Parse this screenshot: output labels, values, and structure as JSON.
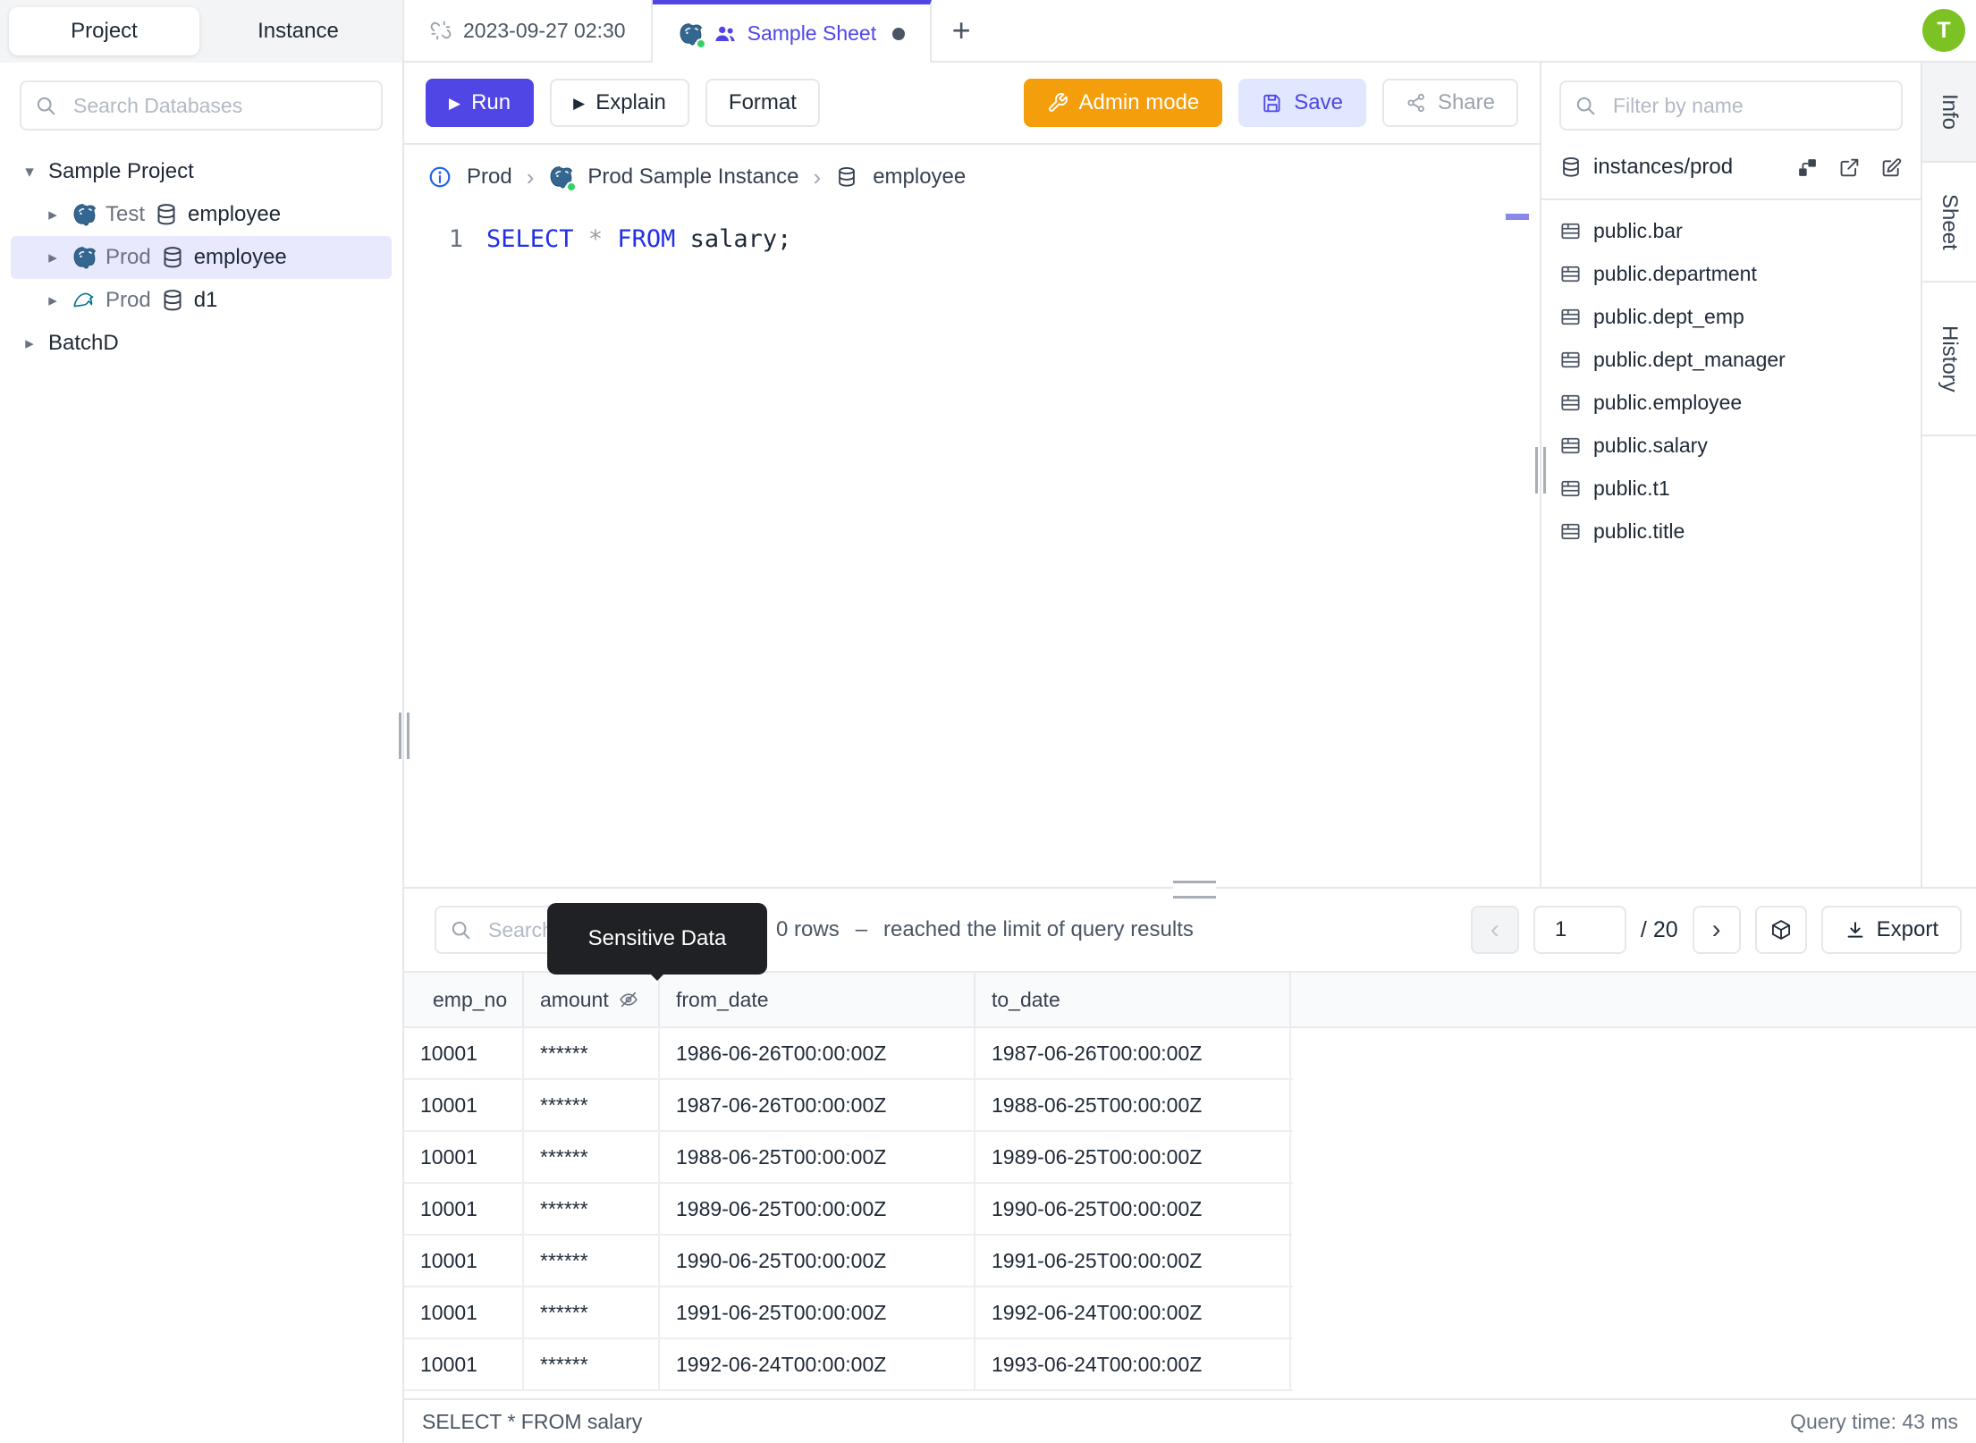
{
  "user": {
    "avatar_initial": "T"
  },
  "left_sidebar": {
    "tabs": {
      "project": "Project",
      "instance": "Instance"
    },
    "search_placeholder": "Search Databases",
    "tree": {
      "root": "Sample Project",
      "databases": [
        {
          "env": "Test",
          "name": "employee",
          "engine": "postgresql"
        },
        {
          "env": "Prod",
          "name": "employee",
          "engine": "postgresql"
        },
        {
          "env": "Prod",
          "name": "d1",
          "engine": "mysql"
        }
      ],
      "collapsed_project": "BatchD"
    }
  },
  "tab_bar": {
    "tabs": [
      {
        "label": "2023-09-27 02:30"
      },
      {
        "label": "Sample Sheet"
      }
    ]
  },
  "toolbar": {
    "run": "Run",
    "explain": "Explain",
    "format": "Format",
    "admin_mode": "Admin mode",
    "save": "Save",
    "share": "Share"
  },
  "breadcrumb": {
    "environment": "Prod",
    "instance": "Prod Sample Instance",
    "database": "employee"
  },
  "editor": {
    "line_number": "1",
    "keyword_select": "SELECT",
    "operator": "*",
    "keyword_from": "FROM",
    "identifier": " salary;"
  },
  "right_sidebar": {
    "filter_placeholder": "Filter by name",
    "schema_path": "instances/prod",
    "tables": [
      "public.bar",
      "public.department",
      "public.dept_emp",
      "public.dept_manager",
      "public.employee",
      "public.salary",
      "public.t1",
      "public.title"
    ]
  },
  "side_tabs": {
    "info": "Info",
    "sheet": "Sheet",
    "history": "History"
  },
  "results": {
    "search_placeholder": "Search",
    "tooltip": "Sensitive Data",
    "rows_text": "0 rows",
    "dash": "–",
    "limit_text": "reached the limit of query results",
    "pagination": {
      "page": "1",
      "total": "/ 20"
    },
    "export_label": "Export",
    "table": {
      "headers": [
        "emp_no",
        "amount",
        "from_date",
        "to_date"
      ],
      "rows": [
        [
          "10001",
          "******",
          "1986-06-26T00:00:00Z",
          "1987-06-26T00:00:00Z"
        ],
        [
          "10001",
          "******",
          "1987-06-26T00:00:00Z",
          "1988-06-25T00:00:00Z"
        ],
        [
          "10001",
          "******",
          "1988-06-25T00:00:00Z",
          "1989-06-25T00:00:00Z"
        ],
        [
          "10001",
          "******",
          "1989-06-25T00:00:00Z",
          "1990-06-25T00:00:00Z"
        ],
        [
          "10001",
          "******",
          "1990-06-25T00:00:00Z",
          "1991-06-25T00:00:00Z"
        ],
        [
          "10001",
          "******",
          "1991-06-25T00:00:00Z",
          "1992-06-24T00:00:00Z"
        ],
        [
          "10001",
          "******",
          "1992-06-24T00:00:00Z",
          "1993-06-24T00:00:00Z"
        ]
      ]
    },
    "status": {
      "executed_sql": "SELECT * FROM salary",
      "query_time": "Query time: 43 ms"
    }
  },
  "colors": {
    "accent": "#4f46e5",
    "accent_soft_bg": "#e0e7ff",
    "admin_orange": "#f59e0b",
    "avatar_green": "#7cc224",
    "selection_bg": "#e8e9fc",
    "keyword_blue": "#2130e8",
    "postgres_blue": "#336791",
    "mysql_teal": "#00758f",
    "tooltip_bg": "#202124",
    "border": "#e5e7eb"
  }
}
